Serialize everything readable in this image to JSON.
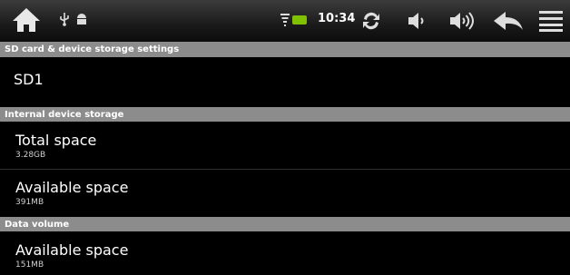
{
  "status_bar": {
    "time": "10:34",
    "icons": [
      "home-icon",
      "usb-icon",
      "android-icon",
      "wifi-icon",
      "battery-icon",
      "sync-icon",
      "volume-down-icon",
      "volume-up-icon",
      "back-icon",
      "menu-icon"
    ],
    "accent_color": "#7fc000"
  },
  "page": {
    "title": "SD card & device storage settings"
  },
  "sd_card": {
    "label": "SD1"
  },
  "internal_storage": {
    "header": "Internal device storage",
    "total_space": {
      "label": "Total space",
      "value": "3.28GB"
    },
    "available_space": {
      "label": "Available space",
      "value": "391MB"
    }
  },
  "data_volume": {
    "header": "Data volume",
    "available_space": {
      "label": "Available space",
      "value": "151MB"
    }
  }
}
